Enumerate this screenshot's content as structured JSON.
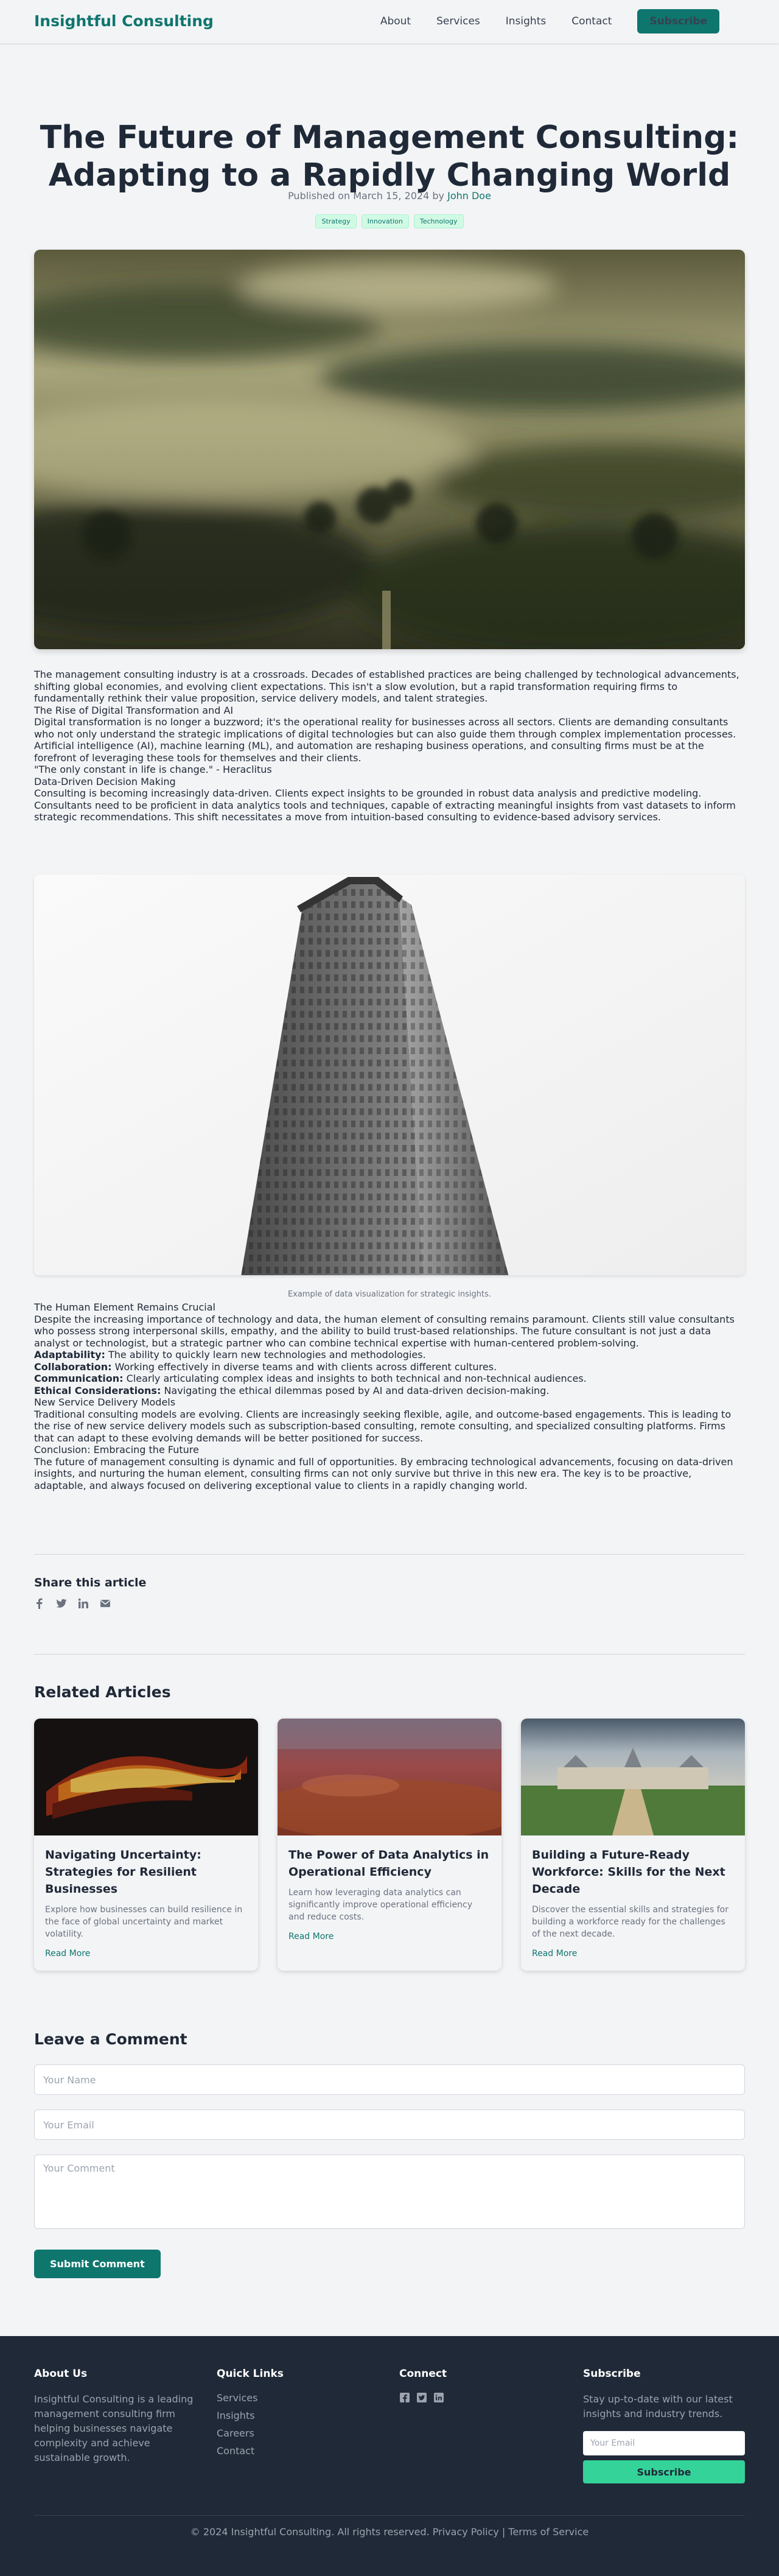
{
  "header": {
    "logo": "Insightful Consulting",
    "nav": [
      "About",
      "Services",
      "Insights",
      "Contact"
    ],
    "subscribe": "Subscribe"
  },
  "article": {
    "title": "The Future of Management Consulting: Adapting to a Rapidly Changing World",
    "meta_prefix": "Published on March 15, 2024 by",
    "author": "John Doe",
    "tags": [
      "Strategy",
      "Innovation",
      "Technology"
    ],
    "intro": "The management consulting industry is at a crossroads. Decades of established practices are being challenged by technological advancements, shifting global economies, and evolving client expectations. This isn't a slow evolution, but a rapid transformation requiring firms to fundamentally rethink their value proposition, service delivery models, and talent strategies.",
    "h_rise": "The Rise of Digital Transformation and AI",
    "p_rise1": "Digital transformation is no longer a buzzword; it's the operational reality for businesses across all sectors. Clients are demanding consultants who not only understand the strategic implications of digital technologies but can also guide them through complex implementation processes.",
    "p_rise2": "Artificial intelligence (AI), machine learning (ML), and automation are reshaping business operations, and consulting firms must be at the forefront of leveraging these tools for themselves and their clients.",
    "quote": "\"The only constant in life is change.\" - Heraclitus",
    "h_data": "Data-Driven Decision Making",
    "p_data1": "Consulting is becoming increasingly data-driven. Clients expect insights to be grounded in robust data analysis and predictive modeling.",
    "p_data2": "Consultants need to be proficient in data analytics tools and techniques, capable of extracting meaningful insights from vast datasets to inform strategic recommendations. This shift necessitates a move from intuition-based consulting to evidence-based advisory services.",
    "caption": "Example of data visualization for strategic insights.",
    "h_human": "The Human Element Remains Crucial",
    "p_human": "Despite the increasing importance of technology and data, the human element of consulting remains paramount. Clients still value consultants who possess strong interpersonal skills, empathy, and the ability to build trust-based relationships. The future consultant is not just a data analyst or technologist, but a strategic partner who can combine technical expertise with human-centered problem-solving.",
    "skills": [
      {
        "term": "Adaptability:",
        "desc": " The ability to quickly learn new technologies and methodologies."
      },
      {
        "term": "Collaboration:",
        "desc": " Working effectively in diverse teams and with clients across different cultures."
      },
      {
        "term": "Communication:",
        "desc": " Clearly articulating complex ideas and insights to both technical and non-technical audiences."
      },
      {
        "term": "Ethical Considerations:",
        "desc": " Navigating the ethical dilemmas posed by AI and data-driven decision-making."
      }
    ],
    "h_models": "New Service Delivery Models",
    "p_models": "Traditional consulting models are evolving. Clients are increasingly seeking flexible, agile, and outcome-based engagements. This is leading to the rise of new service delivery models such as subscription-based consulting, remote consulting, and specialized consulting platforms. Firms that can adapt to these evolving demands will be better positioned for success.",
    "h_conclusion": "Conclusion: Embracing the Future",
    "p_conclusion": "The future of management consulting is dynamic and full of opportunities. By embracing technological advancements, focusing on data-driven insights, and nurturing the human element, consulting firms can not only survive but thrive in this new era. The key is to be proactive, adaptable, and always focused on delivering exceptional value to clients in a rapidly changing world."
  },
  "share": {
    "title": "Share this article",
    "icons": [
      "facebook-icon",
      "twitter-icon",
      "linkedin-icon",
      "email-icon"
    ]
  },
  "related": {
    "title": "Related Articles",
    "cards": [
      {
        "title": "Navigating Uncertainty: Strategies for Resilient Businesses",
        "desc": "Explore how businesses can build resilience in the face of global uncertainty and market volatility.",
        "link": "Read More"
      },
      {
        "title": "The Power of Data Analytics in Operational Efficiency",
        "desc": "Learn how leveraging data analytics can significantly improve operational efficiency and reduce costs.",
        "link": "Read More"
      },
      {
        "title": "Building a Future-Ready Workforce: Skills for the Next Decade",
        "desc": "Discover the essential skills and strategies for building a workforce ready for the challenges of the next decade.",
        "link": "Read More"
      }
    ]
  },
  "comment": {
    "title": "Leave a Comment",
    "name_placeholder": "Your Name",
    "email_placeholder": "Your Email",
    "comment_placeholder": "Your Comment",
    "submit": "Submit Comment"
  },
  "footer": {
    "about_title": "About Us",
    "about_text": "Insightful Consulting is a leading management consulting firm helping businesses navigate complexity and achieve sustainable growth.",
    "links_title": "Quick Links",
    "links": [
      "Services",
      "Insights",
      "Careers",
      "Contact"
    ],
    "connect_title": "Connect",
    "subscribe_title": "Subscribe",
    "subscribe_text": "Stay up-to-date with our latest insights and industry trends.",
    "email_placeholder": "Your Email",
    "subscribe_button": "Subscribe",
    "copyright": "© 2024 Insightful Consulting. All rights reserved. Privacy Policy | Terms of Service"
  },
  "colors": {
    "brand": "#0f766e",
    "footer_bg": "#1f2937",
    "footer_button": "#34d399"
  }
}
